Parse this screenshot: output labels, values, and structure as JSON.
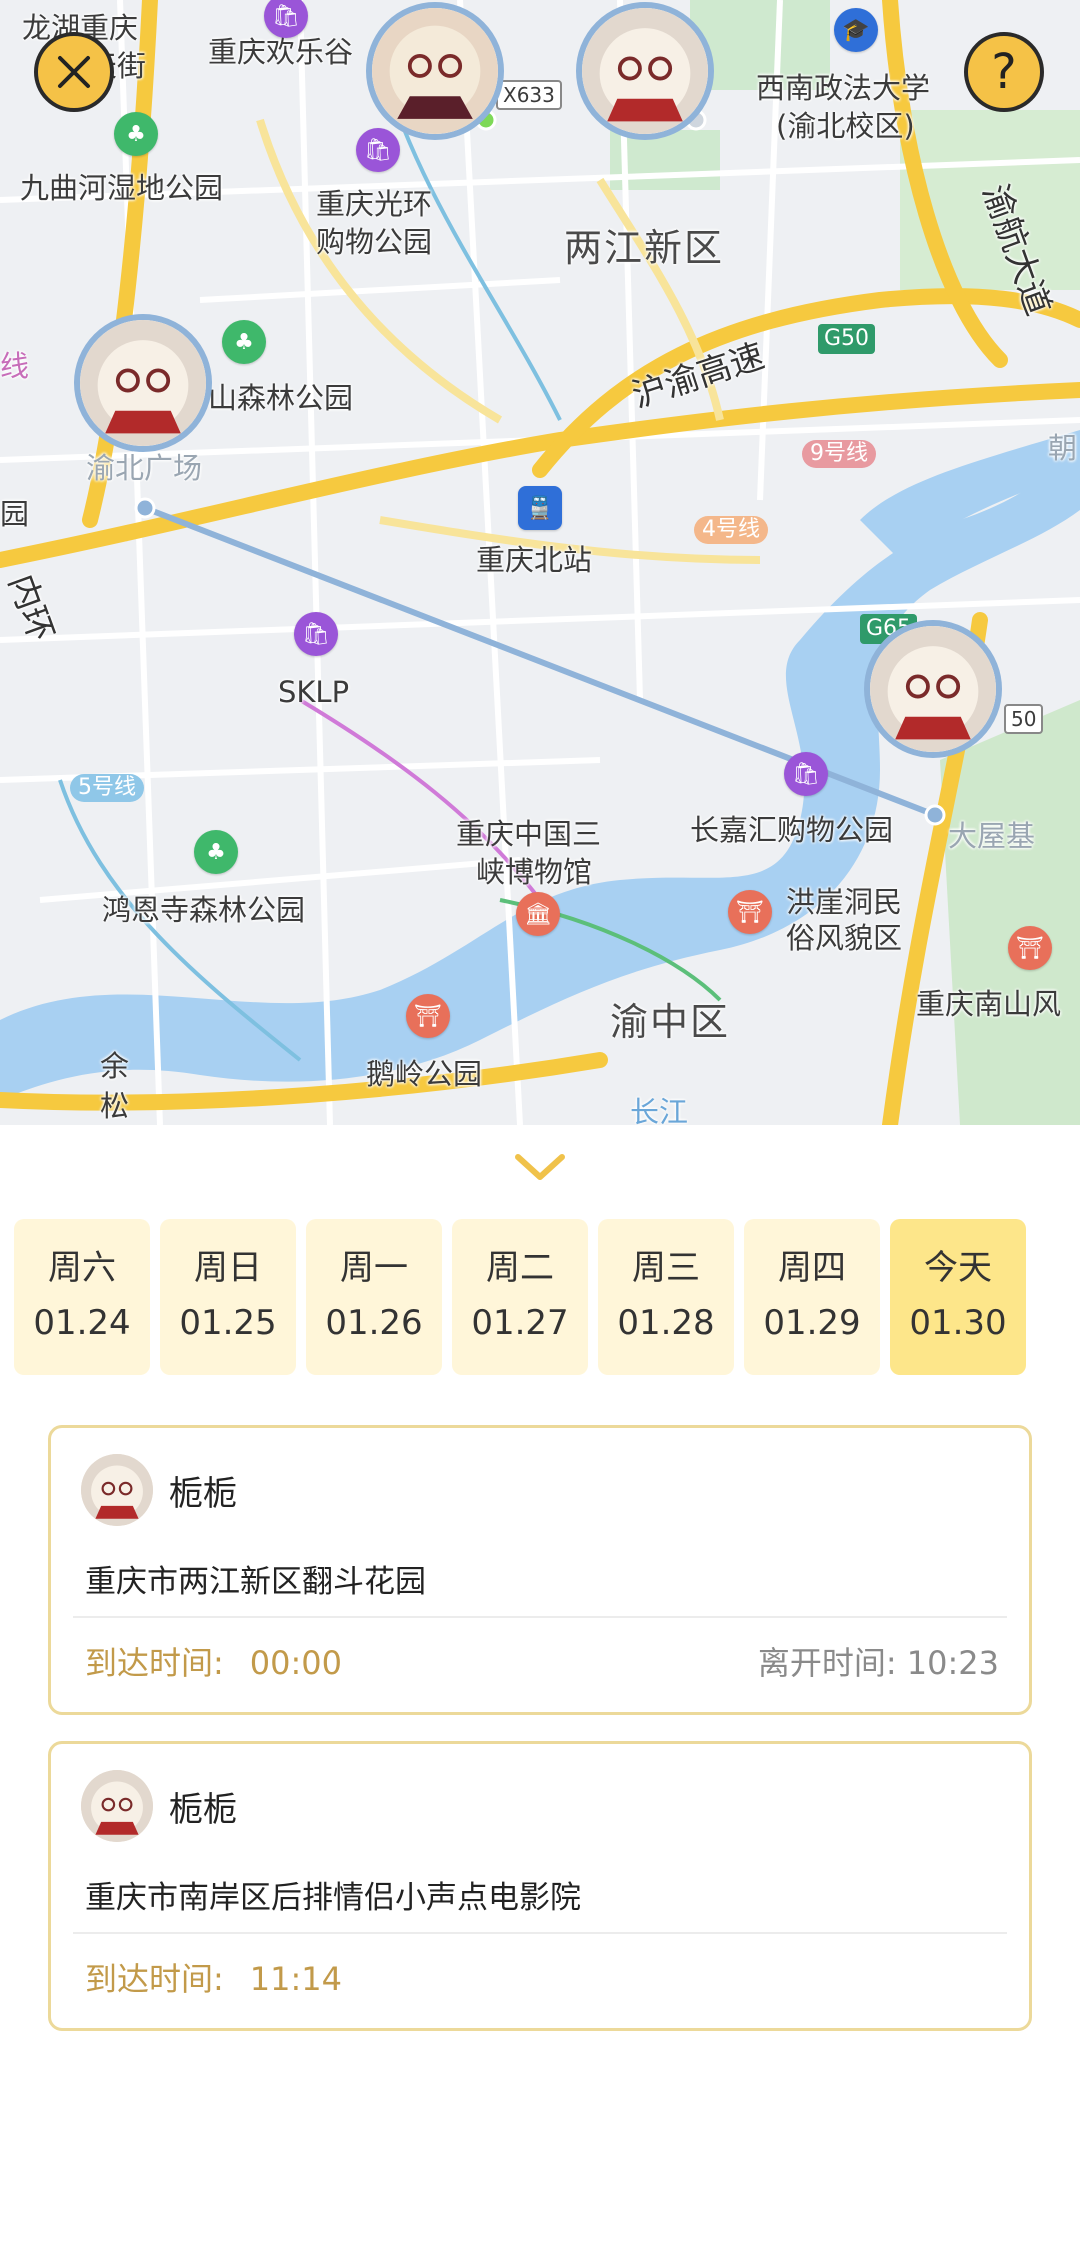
{
  "map": {
    "controls": {
      "close_icon": "close-icon",
      "help_label": "?"
    },
    "labels": {
      "l1": "龙湖重庆",
      "l2": "天街",
      "l3": "重庆欢乐谷",
      "l4": "九曲河湿地公园",
      "l5": "重庆光环",
      "l6": "购物公园",
      "l7": "两江新区",
      "l8": "西南政法大学",
      "l9": "(渝北校区)",
      "l10": "渝航大道",
      "l11": "山森林公园",
      "l12": "渝北广场",
      "l13": "沪渝高速",
      "l14": "重庆北站",
      "l15": "SKLP",
      "l16": "重庆中国三",
      "l17": "峡博物馆",
      "l18": "长嘉汇购物公园",
      "l19": "大屋基",
      "l20": "鸿恩寺森林公园",
      "l21": "洪崖洞民",
      "l22": "俗风貌区",
      "l23": "重庆南山风",
      "l24": "渝中区",
      "l25": "鹅岭公园",
      "l26": "余",
      "l27": "松",
      "l28": "长江",
      "l29": "朝",
      "l30": "线",
      "l31": "园",
      "l32": "内环"
    },
    "road_badges": {
      "x633": "X633",
      "g50": "G50",
      "g65": "G65",
      "b50": "50"
    },
    "metro": {
      "m9": "9号线",
      "m4": "4号线",
      "m5": "5号线"
    }
  },
  "sheet": {
    "dates": [
      {
        "weekday": "周六",
        "date": "01.24"
      },
      {
        "weekday": "周日",
        "date": "01.25"
      },
      {
        "weekday": "周一",
        "date": "01.26"
      },
      {
        "weekday": "周二",
        "date": "01.27"
      },
      {
        "weekday": "周三",
        "date": "01.28"
      },
      {
        "weekday": "周四",
        "date": "01.29"
      },
      {
        "weekday": "今天",
        "date": "01.30"
      }
    ],
    "records": [
      {
        "name": "栀栀",
        "address": "重庆市两江新区翻斗花园",
        "arrive_label": "到达时间:",
        "arrive_time": "00:00",
        "leave_text": "离开时间: 10:23"
      },
      {
        "name": "栀栀",
        "address": "重庆市南岸区后排情侣小声点电影院",
        "arrive_label": "到达时间:",
        "arrive_time": "11:14"
      }
    ]
  }
}
